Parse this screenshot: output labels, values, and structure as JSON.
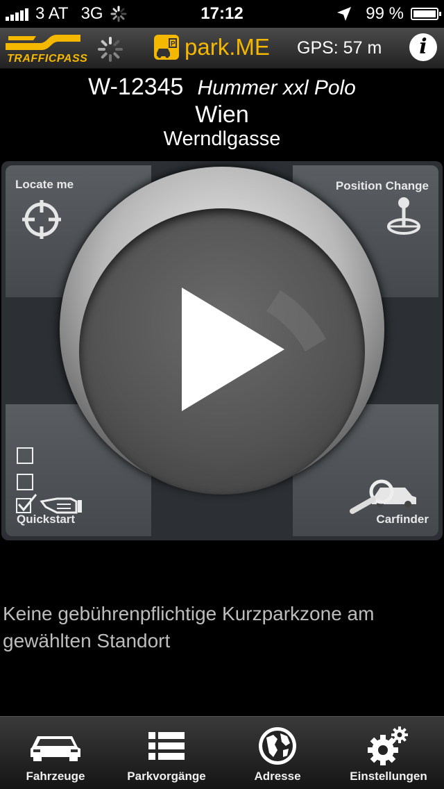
{
  "status_bar": {
    "carrier": "3 AT",
    "network": "3G",
    "time": "17:12",
    "battery": "99 %"
  },
  "nav_bar": {
    "logo_text": "TRAFFICPASS",
    "app_name": "park.ME",
    "gps": "GPS: 57 m",
    "info_label": "i",
    "brand_color": "#f5b800"
  },
  "vehicle": {
    "plate": "W-12345",
    "model": "Hummer xxl Polo",
    "city": "Wien",
    "street": "Werndlgasse"
  },
  "controls": {
    "locate_me": "Locate me",
    "position_change": "Position Change",
    "quickstart": "Quickstart",
    "carfinder": "Carfinder",
    "quickstart_checks": [
      false,
      false,
      true
    ]
  },
  "message": "Keine gebührenpflichtige Kurzparkzone am gewählten Standort",
  "tabs": [
    {
      "label": "Fahrzeuge",
      "icon": "car-icon"
    },
    {
      "label": "Parkvorgänge",
      "icon": "list-icon"
    },
    {
      "label": "Adresse",
      "icon": "globe-icon"
    },
    {
      "label": "Einstellungen",
      "icon": "gear-icon"
    }
  ]
}
